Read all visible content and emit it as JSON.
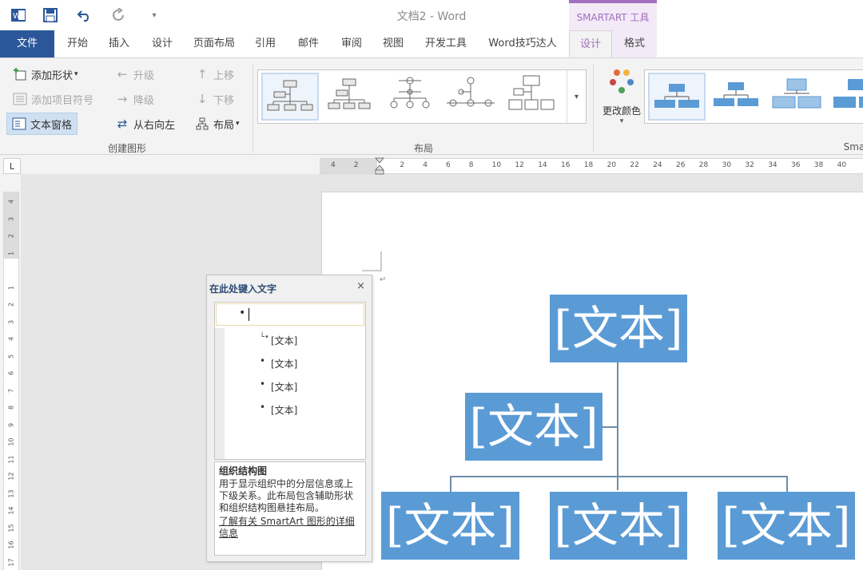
{
  "app": {
    "title": "文档2 - Word",
    "context_tab_group": "SMARTART 工具"
  },
  "tabs": [
    "文件",
    "开始",
    "插入",
    "设计",
    "页面布局",
    "引用",
    "邮件",
    "审阅",
    "视图",
    "开发工具",
    "Word技巧达人",
    "设计",
    "格式"
  ],
  "ribbon": {
    "create_group": {
      "label": "创建图形",
      "add_shape": "添加形状",
      "add_bullet": "添加项目符号",
      "text_pane": "文本窗格",
      "promote": "升级",
      "demote": "降级",
      "right_to_left": "从右向左",
      "move_up": "上移",
      "move_down": "下移",
      "layout": "布局"
    },
    "layouts_group": {
      "label": "布局"
    },
    "styles_group": {
      "change_colors": "更改颜色",
      "label": "Sma"
    }
  },
  "colors": {
    "accent": "#a26fbf",
    "file_tab": "#2b579a",
    "smartart_fill": "#5b9bd5"
  },
  "ruler": {
    "h_ticks": [
      "4",
      "2",
      "",
      "2",
      "4",
      "6",
      "8",
      "10",
      "12",
      "14",
      "16",
      "18",
      "20",
      "22",
      "24",
      "26",
      "28",
      "30",
      "32",
      "34",
      "36",
      "38",
      "40"
    ],
    "v_ticks": [
      "4",
      "3",
      "2",
      "1",
      "",
      "1",
      "2",
      "3",
      "4",
      "5",
      "6",
      "7",
      "8",
      "9",
      "10",
      "11",
      "12",
      "13",
      "14",
      "15",
      "16",
      "17"
    ]
  },
  "ruler_corner": "L",
  "text_pane": {
    "title": "在此处键入文字",
    "items": [
      "[文本]",
      "[文本]",
      "[文本]",
      "[文本]"
    ],
    "desc_title": "组织结构图",
    "desc_body": "用于显示组织中的分层信息或上下级关系。此布局包含辅助形状和组织结构图悬挂布局。",
    "desc_link": "了解有关 SmartArt 图形的详细信息"
  },
  "smartart": {
    "top": "[文本]",
    "assistant": "[文本]",
    "children": [
      "[文本]",
      "[文本]",
      "[文本]"
    ]
  }
}
